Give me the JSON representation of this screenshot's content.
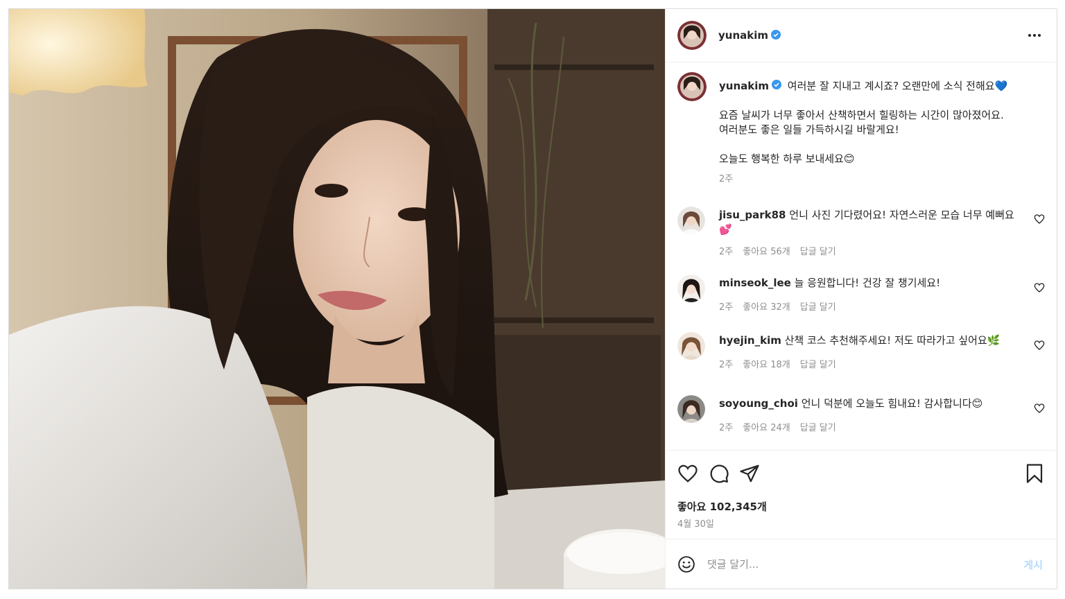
{
  "header": {
    "username": "yunakim",
    "verified": true,
    "more_icon": "more-horizontal-icon"
  },
  "caption": {
    "username": "yunakim",
    "line1": "여러분 잘 지내고 계시죠? 오랜만에 소식 전해요💙",
    "line2": "요즘 날씨가 너무 좋아서 산책하면서 힐링하는 시간이 많아졌어요.",
    "line3": "여러분도 좋은 일들 가득하시길 바랄게요!",
    "line4": "오늘도 행복한 하루 보내세요😊",
    "time": "2주"
  },
  "comments": [
    {
      "username": "jisu_park88",
      "text": "언니 사진 기다렸어요! 자연스러운 모습 너무 예뻐요💕",
      "time": "2주",
      "likes": "좋아요 56개",
      "reply": "답글 달기"
    },
    {
      "username": "minseok_lee",
      "text": "늘 응원합니다! 건강 잘 챙기세요!",
      "time": "2주",
      "likes": "좋아요 32개",
      "reply": "답글 달기"
    },
    {
      "username": "hyejin_kim",
      "text": "산책 코스 추천해주세요! 저도 따라가고 싶어요🌿",
      "time": "2주",
      "likes": "좋아요 18개",
      "reply": "답글 달기"
    },
    {
      "username": "soyoung_choi",
      "text": "언니 덕분에 오늘도 힘내요! 감사합니다😊",
      "time": "2주",
      "likes": "좋아요 24개",
      "reply": "답글 달기"
    }
  ],
  "actions": {
    "like_icon": "heart-icon",
    "comment_icon": "comment-icon",
    "share_icon": "send-icon",
    "save_icon": "bookmark-icon"
  },
  "stats": {
    "likes": "좋아요 102,345개",
    "date": "4월 30일"
  },
  "composer": {
    "placeholder": "댓글 달기...",
    "post_label": "게시",
    "emoji_icon": "smiley-icon"
  },
  "colors": {
    "verified": "#3897f0",
    "post_disabled": "#b3dbff",
    "secondary_text": "#8e8e8e"
  }
}
